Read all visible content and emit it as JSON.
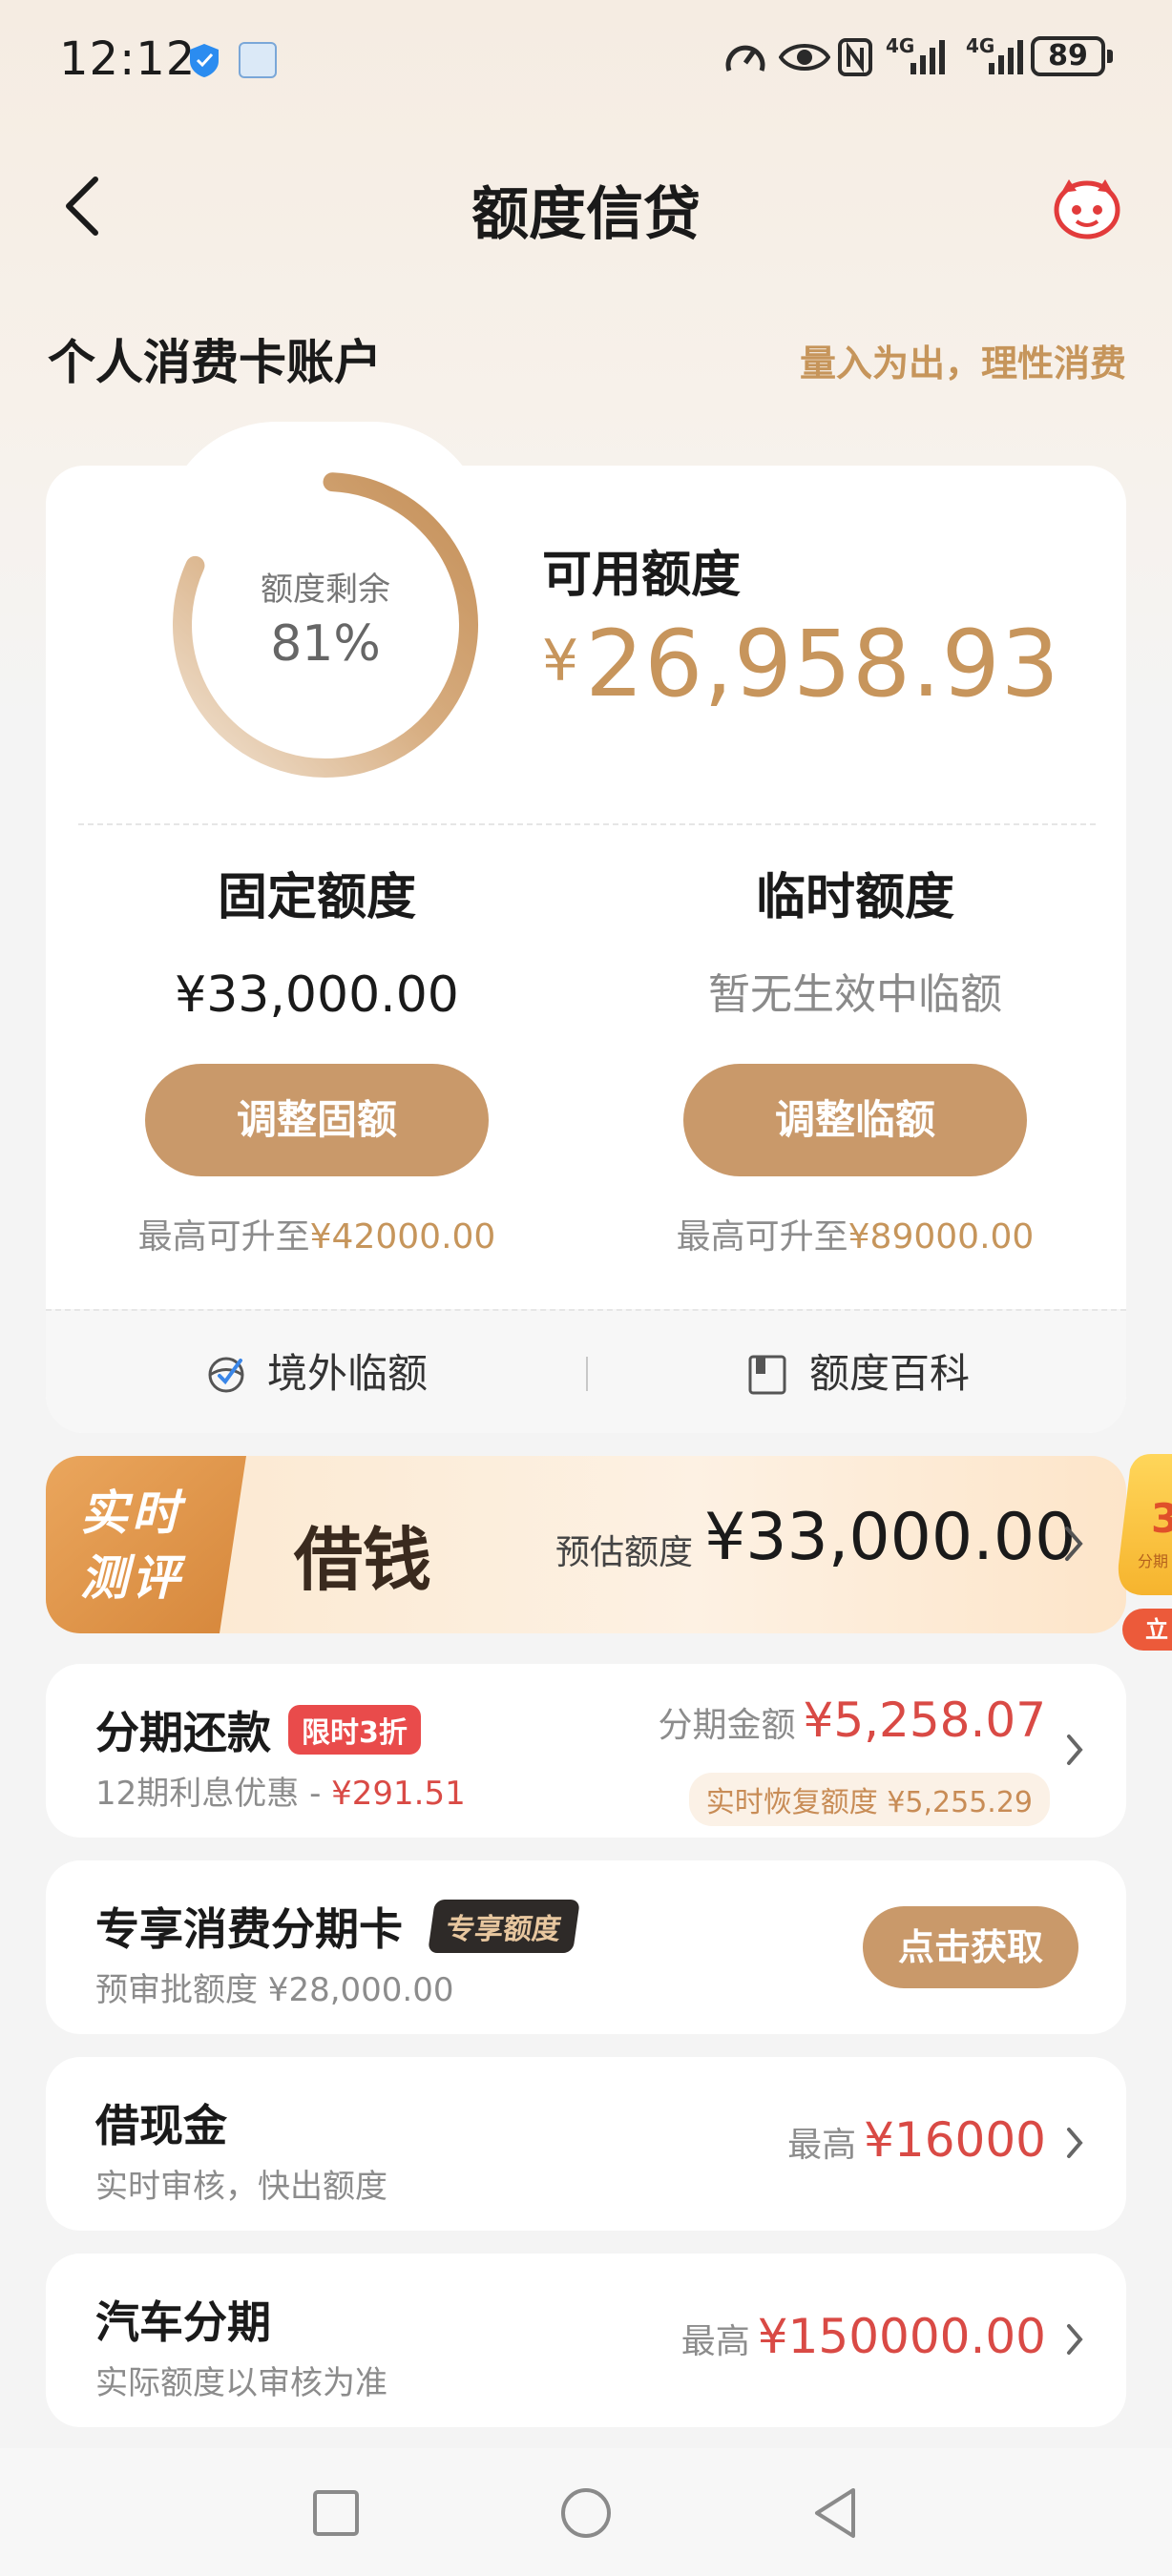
{
  "status_bar": {
    "time": "12:12",
    "network_1": "4G",
    "network_2": "4G",
    "battery": "89"
  },
  "header": {
    "title": "额度信贷"
  },
  "account": {
    "section_title": "个人消费卡账户",
    "slogan": "量入为出，理性消费",
    "remaining_label": "额度剩余",
    "remaining_percent": "81%",
    "remaining_fraction": 0.81,
    "available_label": "可用额度",
    "available_currency": "¥",
    "available_amount": "26,958.93",
    "fixed": {
      "title": "固定额度",
      "value": "¥33,000.00",
      "button": "调整固额",
      "hint_prefix": "最高可升至",
      "hint_amount": "¥42000.00"
    },
    "temporary": {
      "title": "临时额度",
      "value": "暂无生效中临额",
      "button": "调整临额",
      "hint_prefix": "最高可升至",
      "hint_amount": "¥89000.00"
    },
    "footer": {
      "left": "境外临额",
      "right": "额度百科"
    }
  },
  "loan_banner": {
    "tag_line1": "实时",
    "tag_line2": "测评",
    "title": "借钱",
    "est_label": "预估额度",
    "est_amount": "¥33,000.00"
  },
  "side_badge": {
    "digit": "3",
    "label": "分期",
    "button": "立"
  },
  "items": [
    {
      "title": "分期还款",
      "tag": "限时3折",
      "sub_prefix": "12期利息优惠 - ",
      "sub_amount": "¥291.51",
      "right_label": "分期金额",
      "right_amount": "¥5,258.07",
      "note": "实时恢复额度 ¥5,255.29"
    },
    {
      "title": "专享消费分期卡",
      "tag": "专享额度",
      "sub": "预审批额度 ¥28,000.00",
      "button": "点击获取"
    },
    {
      "title": "借现金",
      "sub": "实时审核，快出额度",
      "right_label": "最高",
      "right_amount": "¥16000"
    },
    {
      "title": "汽车分期",
      "sub": "实际额度以审核为准",
      "right_label": "最高",
      "right_amount": "¥150000.00"
    }
  ],
  "colors": {
    "gold": "#c7955c",
    "button_gold": "#c9996a",
    "red": "#d94a45"
  }
}
